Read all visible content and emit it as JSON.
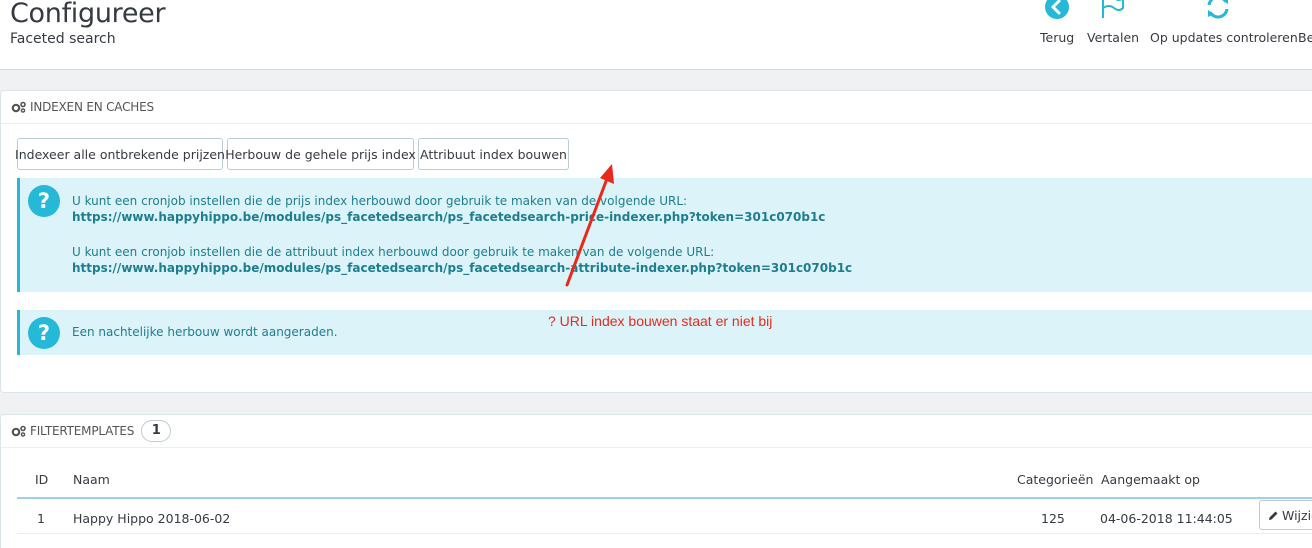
{
  "header": {
    "title": "Configureer",
    "subtitle": "Faceted search",
    "toolbar": [
      {
        "label": "Terug",
        "icon": "arrow-left-circle-icon"
      },
      {
        "label": "Vertalen",
        "icon": "flag-icon"
      },
      {
        "label": "Op updates controleren",
        "icon": "refresh-icon"
      },
      {
        "label": "Be",
        "icon": "book-icon"
      }
    ]
  },
  "indexes_panel": {
    "heading": "INDEXEN EN CACHES",
    "buttons": [
      "Indexeer alle ontbrekende prijzen",
      "Herbouw de gehele prijs index",
      "Attribuut index bouwen"
    ],
    "info_alert": {
      "price_text": "U kunt een cronjob instellen die de prijs index herbouwd door gebruik te maken van de volgende URL:",
      "price_url": "https://www.happyhippo.be/modules/ps_facetedsearch/ps_facetedsearch-price-indexer.php?token=301c070b1c",
      "attribute_text": "U kunt een cronjob instellen die de attribuut index herbouwd door gebruik te maken van de volgende URL:",
      "attribute_url": "https://www.happyhippo.be/modules/ps_facetedsearch/ps_facetedsearch-attribute-indexer.php?token=301c070b1c"
    },
    "nightly_alert": "Een nachtelijke herbouw wordt aangeraden.",
    "annotation": "? URL index bouwen staat er niet bij"
  },
  "templates_panel": {
    "heading": "FILTERTEMPLATES",
    "count": "1",
    "columns": {
      "id": "ID",
      "name": "Naam",
      "categories": "Categorieën",
      "created": "Aangemaakt op"
    },
    "rows": [
      {
        "id": "1",
        "name": "Happy Hippo 2018-06-02",
        "categories": "125",
        "created": "04-06-2018 11:44:05",
        "edit_label": "Wijzig"
      }
    ]
  },
  "colors": {
    "accent": "#25b9d7",
    "alert_bg": "#dcf4f9",
    "annotation_red": "#e8291c"
  }
}
